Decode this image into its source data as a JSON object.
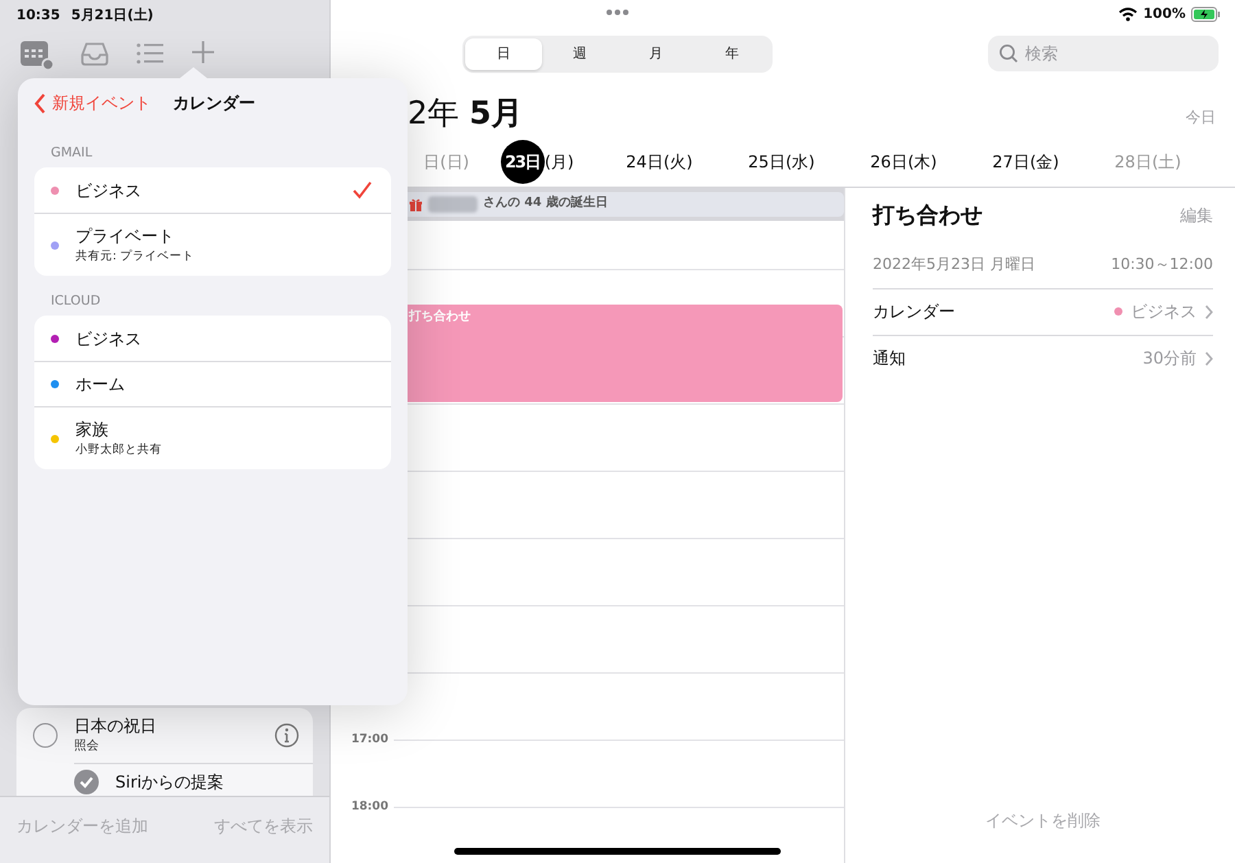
{
  "status_bar": {
    "time": "10:35",
    "date": "5月21日(土)",
    "battery": "100%"
  },
  "sidebar": {
    "calendars": [
      {
        "name": "日本の祝日",
        "subtitle": "照会",
        "checked": false
      },
      {
        "name": "Siriからの提案",
        "checked": true
      }
    ],
    "footer": {
      "add": "カレンダーを追加",
      "show_all": "すべてを表示"
    }
  },
  "view_tabs": [
    {
      "label": "日",
      "selected": true
    },
    {
      "label": "週",
      "selected": false
    },
    {
      "label": "月",
      "selected": false
    },
    {
      "label": "年",
      "selected": false
    }
  ],
  "search": {
    "placeholder": "検索"
  },
  "header": {
    "year": "2年",
    "month": "5月",
    "today": "今日"
  },
  "days": [
    {
      "date": "日",
      "weekday": "(日)",
      "dimmed": true,
      "selected": false
    },
    {
      "date": "23日",
      "weekday": "(月)",
      "dimmed": false,
      "selected": true
    },
    {
      "date": "24日",
      "weekday": "(火)",
      "dimmed": false,
      "selected": false
    },
    {
      "date": "25日",
      "weekday": "(水)",
      "dimmed": false,
      "selected": false
    },
    {
      "date": "26日",
      "weekday": "(木)",
      "dimmed": false,
      "selected": false
    },
    {
      "date": "27日",
      "weekday": "(金)",
      "dimmed": false,
      "selected": false
    },
    {
      "date": "28日",
      "weekday": "(土)",
      "dimmed": true,
      "selected": false
    }
  ],
  "all_day_event": {
    "text": "さんの 44 歳の誕生日"
  },
  "event": {
    "title": "打ち合わせ",
    "color": "#f598b8"
  },
  "time_labels": [
    "17:00",
    "18:00"
  ],
  "detail": {
    "title": "打ち合わせ",
    "edit": "編集",
    "date": "2022年5月23日 月曜日",
    "time": "10:30～12:00",
    "rows": [
      {
        "label": "カレンダー",
        "value": "ビジネス",
        "color": "#f08fb0"
      },
      {
        "label": "通知",
        "value": "30分前"
      }
    ],
    "delete": "イベントを削除"
  },
  "popover": {
    "back": "新規イベント",
    "title": "カレンダー",
    "sections": [
      {
        "header": "GMAIL",
        "items": [
          {
            "name": "ビジネス",
            "color": "#ee8fb0",
            "selected": true
          },
          {
            "name": "プライベート",
            "subtitle": "共有元: プライベート",
            "color": "#a0a0f5",
            "selected": false
          }
        ]
      },
      {
        "header": "ICLOUD",
        "items": [
          {
            "name": "ビジネス",
            "color": "#b31fb3",
            "selected": false
          },
          {
            "name": "ホーム",
            "color": "#1e8ff0",
            "selected": false
          },
          {
            "name": "家族",
            "subtitle": "小野太郎と共有",
            "color": "#f5c400",
            "selected": false
          }
        ]
      }
    ]
  }
}
